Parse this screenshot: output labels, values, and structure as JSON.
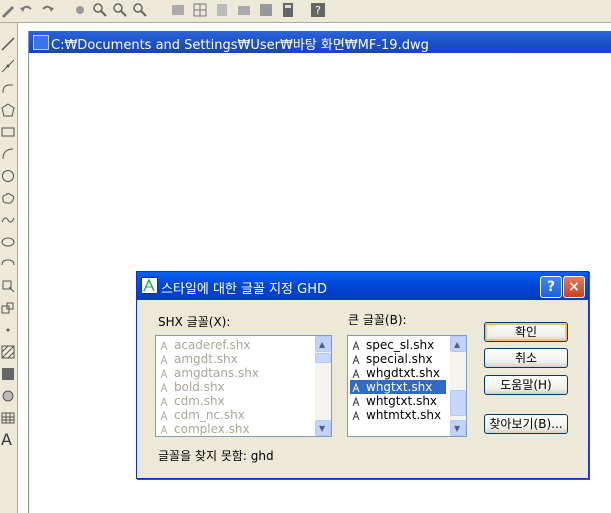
{
  "document": {
    "title": "C:₩Documents and Settings₩User₩바탕 화면₩MF-19.dwg"
  },
  "dialog": {
    "title": "스타일에 대한 글꼴 지정 GHD",
    "help_label": "?",
    "close_label": "×",
    "shx_label": "SHX 글꼴(X):",
    "bigfont_label": "큰 글꼴(B):",
    "shx_fonts": [
      "acaderef.shx",
      "amgdt.shx",
      "amgdtans.shx",
      "bold.shx",
      "cdm.shx",
      "cdm_nc.shx",
      "complex.shx"
    ],
    "big_fonts": [
      "spec_sl.shx",
      "special.shx",
      "whgdtxt.shx",
      "whgtxt.shx",
      "whtgtxt.shx",
      "whtmtxt.shx"
    ],
    "selected_big_font": "whgtxt.shx",
    "status": "글꼴을 찾지 못함: ghd",
    "buttons": {
      "ok": "확인",
      "cancel": "취소",
      "help": "도움말(H)",
      "browse": "찾아보기(B)..."
    }
  },
  "toolbar": {
    "left_text_tool": "A"
  }
}
